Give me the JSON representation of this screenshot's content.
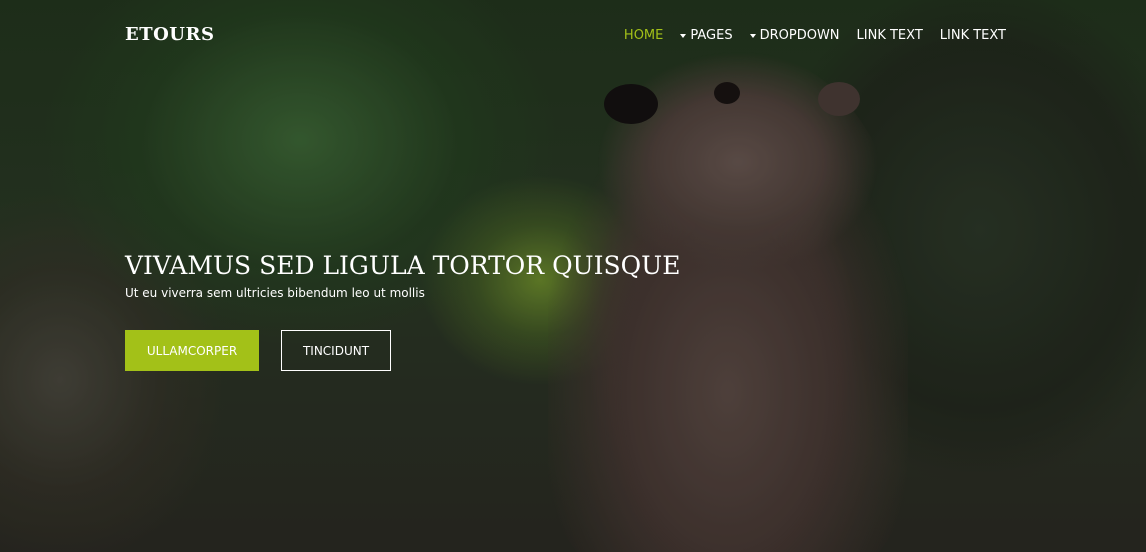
{
  "header": {
    "brand": "ETOURS",
    "nav": [
      {
        "label": "HOME",
        "active": true,
        "dropdown": false
      },
      {
        "label": "PAGES",
        "active": false,
        "dropdown": true
      },
      {
        "label": "DROPDOWN",
        "active": false,
        "dropdown": true
      },
      {
        "label": "LINK TEXT",
        "active": false,
        "dropdown": false
      },
      {
        "label": "LINK TEXT",
        "active": false,
        "dropdown": false
      }
    ]
  },
  "hero": {
    "title": "VIVAMUS SED LIGULA TORTOR QUISQUE",
    "subtitle": "Ut eu viverra sem ultricies bibendum leo ut mollis",
    "primary_button": "ULLAMCORPER",
    "secondary_button": "TINCIDUNT"
  },
  "colors": {
    "accent": "#a3c118",
    "text": "#ffffff"
  },
  "icons": {
    "dropdown": "caret-down-icon"
  }
}
